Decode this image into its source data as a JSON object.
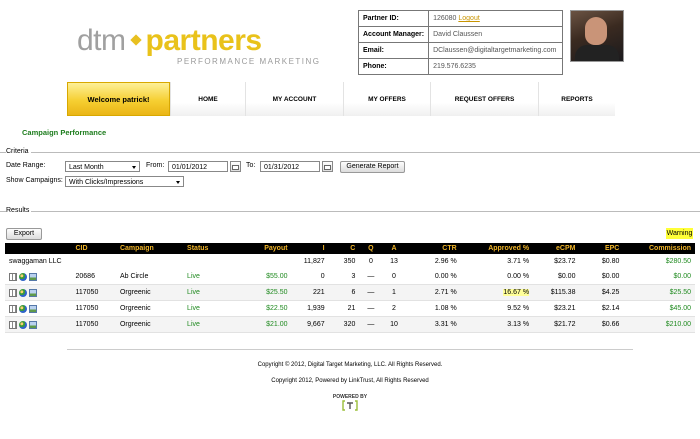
{
  "logo": {
    "dtm": "dtm",
    "partners": "partners",
    "tagline": "PERFORMANCE MARKETING"
  },
  "partner_info": {
    "rows": [
      {
        "key": "Partner ID:",
        "value": "126080",
        "link": "Logout"
      },
      {
        "key": "Account Manager:",
        "value": "David Claussen"
      },
      {
        "key": "Email:",
        "value": "DClaussen@digitaltargetmarketing.com"
      },
      {
        "key": "Phone:",
        "value": "219.576.6235"
      }
    ]
  },
  "nav": {
    "welcome": "Welcome patrick!",
    "items": [
      "HOME",
      "MY ACCOUNT",
      "MY OFFERS",
      "REQUEST OFFERS",
      "REPORTS"
    ]
  },
  "section_title": "Campaign Performance",
  "criteria": {
    "legend": "Criteria",
    "date_range_label": "Date Range:",
    "date_range_value": "Last Month",
    "from_label": "From:",
    "from_value": "01/01/2012",
    "to_label": "To:",
    "to_value": "01/31/2012",
    "generate_button": "Generate Report",
    "show_campaigns_label": "Show Campaigns:",
    "show_campaigns_value": "With Clicks/Impressions"
  },
  "results": {
    "legend": "Results",
    "export_button": "Export",
    "warning_label": "Warning",
    "columns": [
      "",
      "CID",
      "Campaign",
      "Status",
      "Payout",
      "I",
      "C",
      "Q",
      "A",
      "CTR",
      "Approved %",
      "eCPM",
      "EPC",
      "Commission"
    ],
    "summary": {
      "name": "swaggaman LLC",
      "i": "11,827",
      "c": "350",
      "q": "0",
      "a": "13",
      "ctr": "2.96 %",
      "approved": "3.71 %",
      "ecpm": "$23.72",
      "epc": "$0.80",
      "commission": "$280.50"
    },
    "rows": [
      {
        "cid": "20686",
        "campaign": "Ab Circle",
        "status": "Live",
        "payout": "$55.00",
        "i": "0",
        "c": "3",
        "q": "—",
        "a": "0",
        "ctr": "0.00 %",
        "approved": "0.00 %",
        "ecpm": "$0.00",
        "epc": "$0.00",
        "commission": "$0.00"
      },
      {
        "cid": "117050",
        "campaign": "Orgreenic",
        "status": "Live",
        "payout": "$25.50",
        "i": "221",
        "c": "6",
        "q": "—",
        "a": "1",
        "ctr": "2.71 %",
        "approved": "16.67 %",
        "ecpm": "$115.38",
        "epc": "$4.25",
        "commission": "$25.50"
      },
      {
        "cid": "117050",
        "campaign": "Orgreenic",
        "status": "Live",
        "payout": "$22.50",
        "i": "1,939",
        "c": "21",
        "q": "—",
        "a": "2",
        "ctr": "1.08 %",
        "approved": "9.52 %",
        "ecpm": "$23.21",
        "epc": "$2.14",
        "commission": "$45.00"
      },
      {
        "cid": "117050",
        "campaign": "Orgreenic",
        "status": "Live",
        "payout": "$21.00",
        "i": "9,667",
        "c": "320",
        "q": "—",
        "a": "10",
        "ctr": "3.31 %",
        "approved": "3.13 %",
        "ecpm": "$21.72",
        "epc": "$0.66",
        "commission": "$210.00"
      }
    ]
  },
  "footer": {
    "copyright1": "Copyright © 2012, Digital Target Marketing, LLC. All Rights Reserved.",
    "copyright2": "Copyright 2012, Powered by LinkTrust, All Rights Reserved",
    "powered_by": "POWERED BY"
  },
  "colors": {
    "accent_yellow": "#e9c21a",
    "green": "#1f8a1f",
    "header_orange": "#f0b428"
  }
}
